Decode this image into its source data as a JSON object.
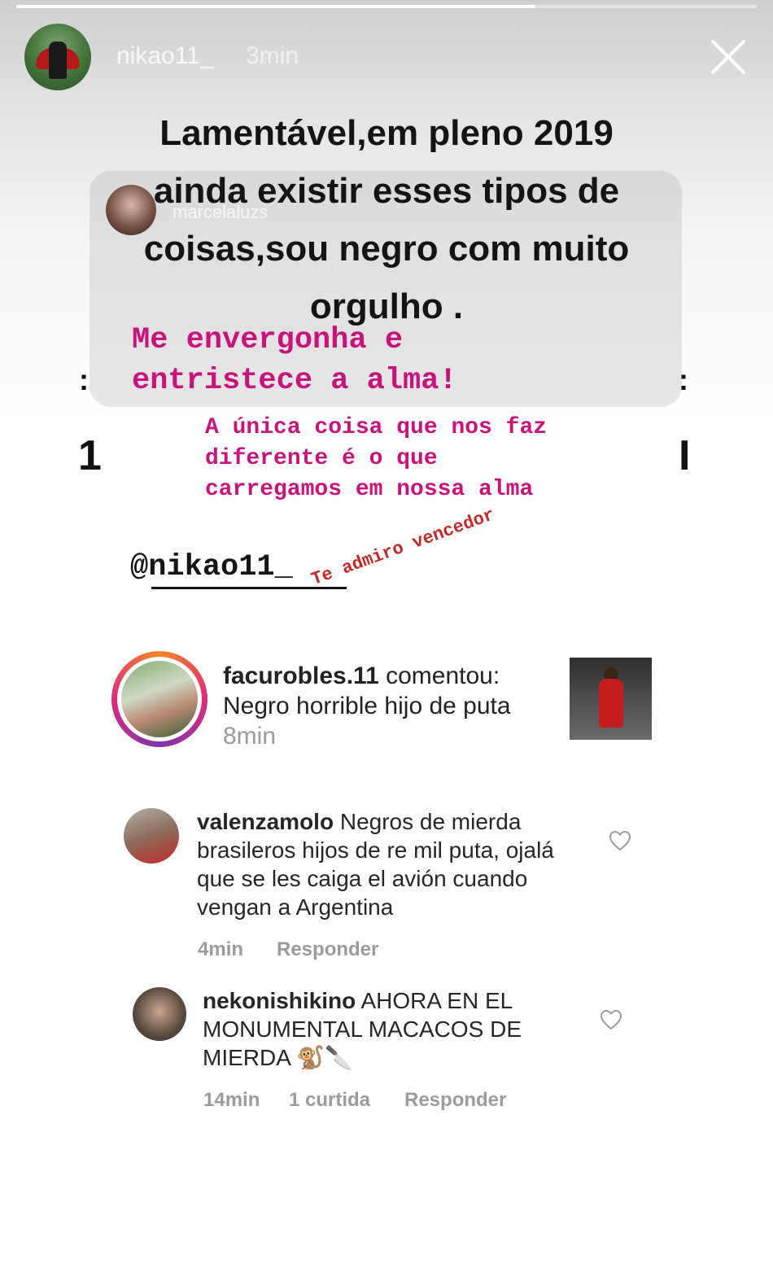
{
  "story": {
    "progress": 0.7,
    "username": "nikao11_",
    "time": "3min",
    "caption": "Lamentável,em pleno 2019 ainda existir esses tipos de coisas,sou negro com muito orgulho ."
  },
  "repost": {
    "username": "marcelaluzs",
    "text1": "Me envergonha e entristece a alma!",
    "text2": "A única coisa que nos faz diferente é o que carregamos em nossa alma",
    "mention": "@nikao11_",
    "handwritten": "Te admiro vencedor"
  },
  "notification": {
    "username": "facurobles.11",
    "action": "comentou:",
    "text": "Negro horrible hijo de puta",
    "time": "8min"
  },
  "comments": [
    {
      "username": "valenzamolo",
      "text": "Negros de mierda brasileros hijos de re mil puta, ojalá que se les caiga el avión cuando vengan a Argentina",
      "time": "4min",
      "reply": "Responder"
    },
    {
      "username": "nekonishikino",
      "text": "AHORA EN EL MONUMENTAL MACACOS DE MIERDA 🐒🔪",
      "time": "14min",
      "likes": "1 curtida",
      "reply": "Responder"
    }
  ],
  "icons": {
    "close": "close-icon",
    "heart": "heart-icon"
  }
}
